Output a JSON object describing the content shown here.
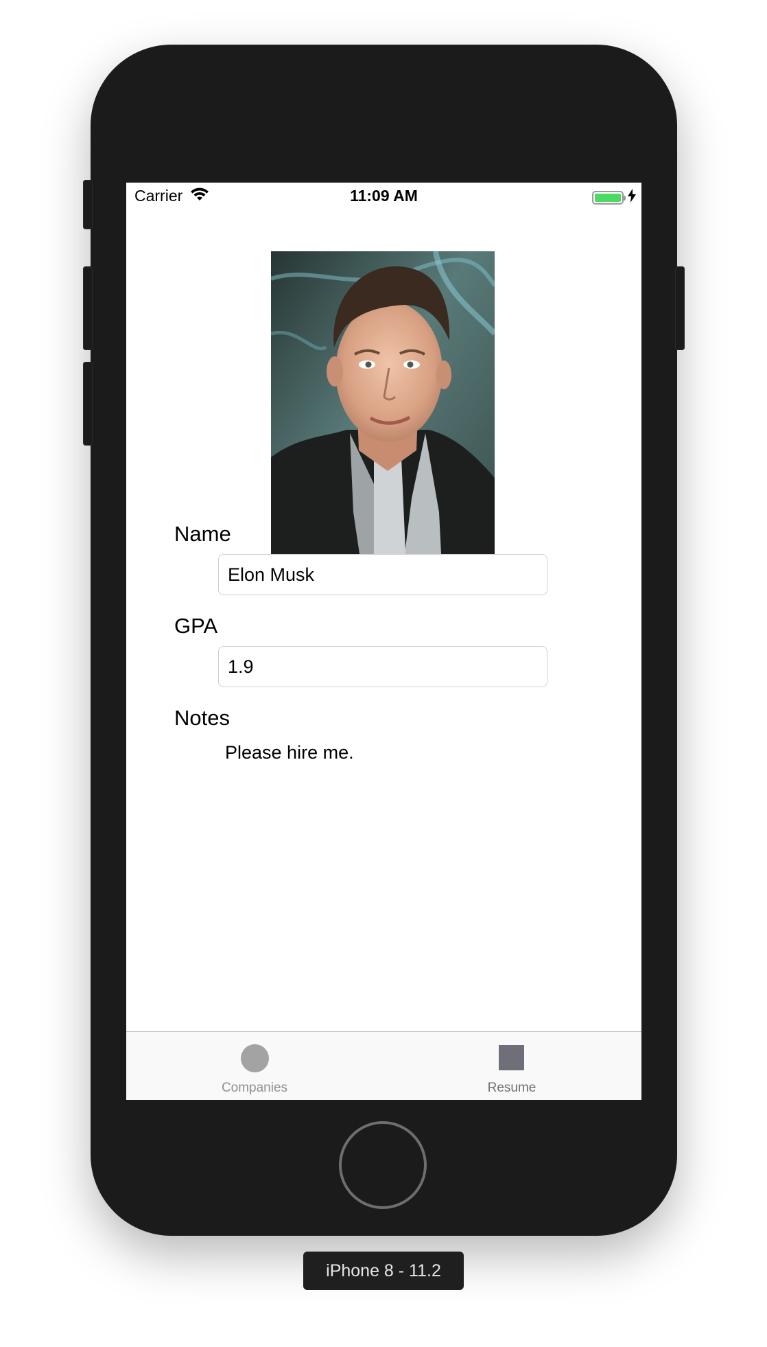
{
  "status_bar": {
    "carrier": "Carrier",
    "wifi_icon": "wifi-icon",
    "time": "11:09 AM",
    "battery_icon": "battery-icon",
    "charging_icon": "charging-bolt-icon",
    "battery_level": 1.0,
    "battery_color": "#4cd964"
  },
  "profile": {
    "photo_icon": "profile-photo",
    "name_label": "Name",
    "name_value": "Elon Musk",
    "gpa_label": "GPA",
    "gpa_value": "1.9",
    "notes_label": "Notes",
    "notes_value": "Please hire me."
  },
  "tab_bar": {
    "tabs": [
      {
        "label": "Companies",
        "icon": "circle-icon",
        "selected": false
      },
      {
        "label": "Resume",
        "icon": "square-icon",
        "selected": true
      }
    ],
    "inactive_color": "#8e8e93",
    "active_color": "#6d6f78"
  },
  "simulator": {
    "device_label": "iPhone 8 - 11.2"
  }
}
